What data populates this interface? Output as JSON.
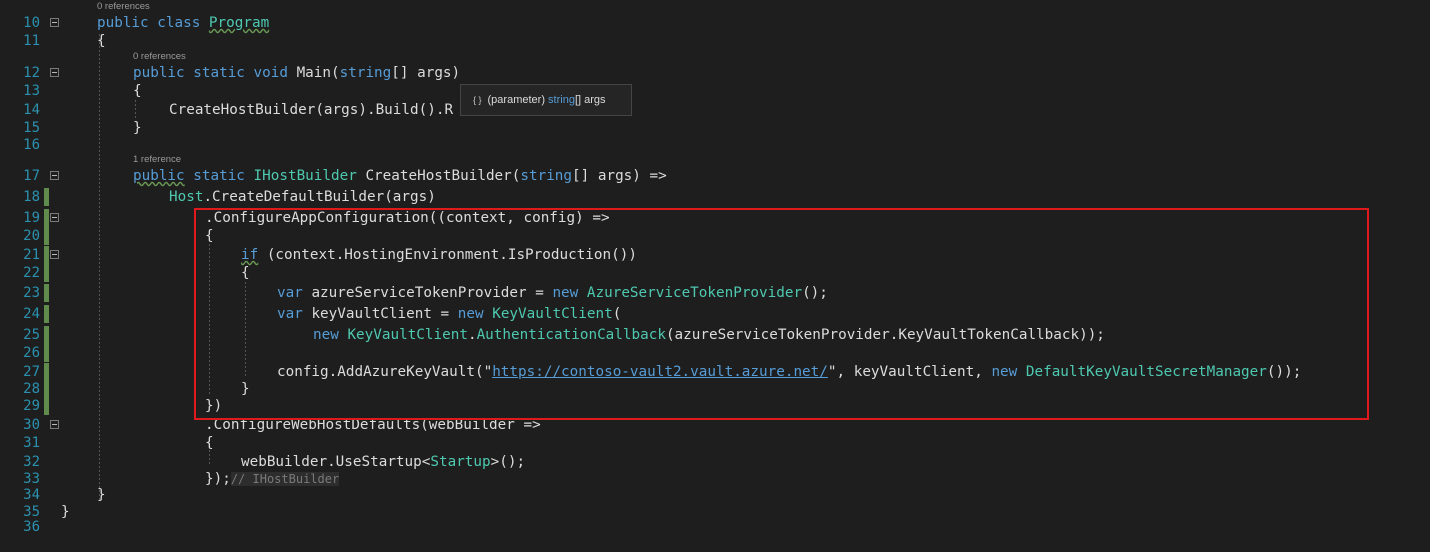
{
  "codelens": {
    "line10": "0 references",
    "line12": "0 references",
    "line17": "1 reference"
  },
  "line_numbers": [
    "10",
    "11",
    "12",
    "13",
    "14",
    "15",
    "16",
    "17",
    "18",
    "19",
    "20",
    "21",
    "22",
    "23",
    "24",
    "25",
    "26",
    "27",
    "28",
    "29",
    "30",
    "31",
    "32",
    "33",
    "34",
    "35",
    "36"
  ],
  "code": {
    "l10": {
      "kw1": "public",
      "kw2": "class",
      "name": "Program"
    },
    "l11": {
      "text": "{"
    },
    "l12": {
      "kw1": "public",
      "kw2": "static",
      "kw3": "void",
      "rest": "Main(",
      "kw4": "string",
      "rest2": "[] args)"
    },
    "l13": {
      "text": "{"
    },
    "l14": {
      "text": "CreateHostBuilder(args).Build().R"
    },
    "l15": {
      "text": "}"
    },
    "l17": {
      "kw1": "public",
      "kw2": "static",
      "type": "IHostBuilder",
      "rest": "CreateHostBuilder(",
      "kw3": "string",
      "rest2": "[] args) =>"
    },
    "l18": {
      "type": "Host",
      "rest": ".CreateDefaultBuilder(args)"
    },
    "l19": {
      "text": ".ConfigureAppConfiguration((context, config) =>"
    },
    "l20": {
      "text": "{"
    },
    "l21": {
      "kw": "if",
      "rest": "(context.HostingEnvironment.IsProduction())"
    },
    "l22": {
      "text": "{"
    },
    "l23": {
      "kw": "var",
      "rest": "azureServiceTokenProvider =",
      "kw2": "new",
      "type": "AzureServiceTokenProvider",
      "rest2": "();"
    },
    "l24": {
      "kw": "var",
      "rest": "keyVaultClient =",
      "kw2": "new",
      "type": "KeyVaultClient",
      "rest2": "("
    },
    "l25": {
      "kw": "new",
      "type": "KeyVaultClient",
      "rest": ".",
      "type2": "AuthenticationCallback",
      "rest2": "(azureServiceTokenProvider.KeyVaultTokenCallback));"
    },
    "l27": {
      "rest": "config.AddAzureKeyVault(\"",
      "url": "https://contoso-vault2.vault.azure.net/",
      "rest2": "\", keyVaultClient,",
      "kw": "new",
      "type": "DefaultKeyVaultSecretManager",
      "rest3": "());"
    },
    "l28": {
      "text": "}"
    },
    "l29": {
      "text": "})"
    },
    "l30": {
      "text": ".ConfigureWebHostDefaults(webBuilder =>"
    },
    "l31": {
      "text": "{"
    },
    "l32": {
      "rest": "webBuilder.UseStartup<",
      "type": "Startup",
      "rest2": ">();"
    },
    "l33": {
      "rest": "});",
      "comment": "// IHostBuilder"
    },
    "l34": {
      "text": "}"
    },
    "l35": {
      "text": "}"
    }
  },
  "tooltip": {
    "icon": "{ }",
    "kind": "(parameter)",
    "type": "string",
    "rest": "[] args"
  },
  "colors": {
    "keyword": "#569cd6",
    "type": "#4ec9b0",
    "highlight_box": "#e0191c",
    "line_number": "#2b91af"
  }
}
